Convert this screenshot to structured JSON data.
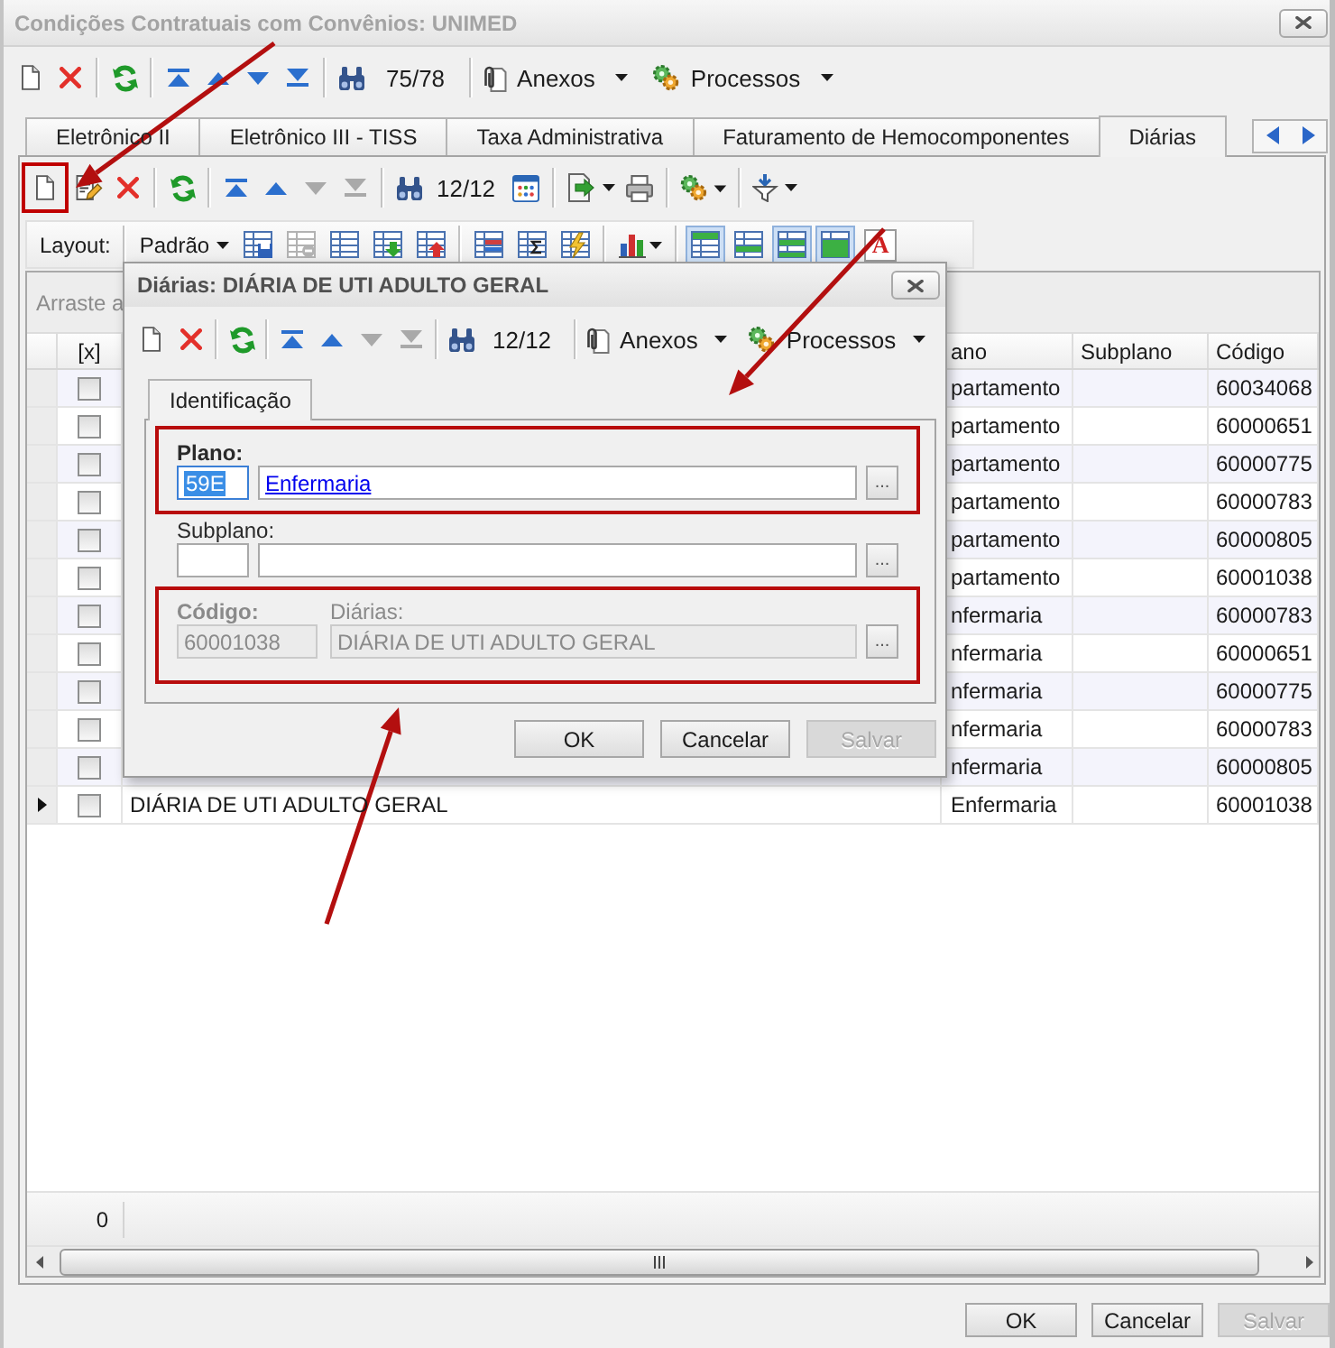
{
  "window": {
    "title": "Condições Contratuais com Convênios: UNIMED"
  },
  "toolbar": {
    "navigation": [
      {
        "disabled": false
      },
      {
        "disabled": false
      },
      {
        "disabled": false
      },
      {
        "disabled": false
      }
    ],
    "record_counter": "75/78",
    "menus": [
      {
        "label": "Anexos"
      },
      {
        "label": "Processos"
      }
    ]
  },
  "tabs": [
    {
      "label": "Eletrônico II",
      "selected": false
    },
    {
      "label": "Eletrônico III - TISS",
      "selected": false
    },
    {
      "label": "Taxa Administrativa",
      "selected": false
    },
    {
      "label": "Faturamento de Hemocomponentes",
      "selected": false
    },
    {
      "label": "Diárias",
      "selected": true
    }
  ],
  "grid_toolbar": {
    "new_highlighted": true,
    "navigation": [
      {
        "disabled": false
      },
      {
        "disabled": false
      },
      {
        "disabled": true
      },
      {
        "disabled": true
      }
    ],
    "record_counter": "12/12"
  },
  "layout_bar": {
    "label": "Layout:",
    "layout": "Padrão",
    "actions": [
      {
        "disabled": false
      },
      {
        "disabled": true
      },
      {
        "disabled": false
      },
      {
        "disabled": false
      },
      {
        "disabled": false
      }
    ],
    "view_toggles": [
      {
        "on": true
      },
      {
        "on": false
      },
      {
        "on": true
      },
      {
        "on": true
      }
    ],
    "font_button": "A"
  },
  "grid": {
    "group_panel_hint": "Arraste a",
    "columns": {
      "checkbox": "[x]",
      "column_4": "ano",
      "subplan": "Subplano",
      "code": "Código"
    },
    "rows": [
      {
        "selected": false,
        "checked": false,
        "column_4": "partamento",
        "code": "60034068"
      },
      {
        "selected": false,
        "checked": false,
        "column_4": "partamento",
        "code": "60000651"
      },
      {
        "selected": false,
        "checked": false,
        "column_4": "partamento",
        "code": "60000775"
      },
      {
        "selected": false,
        "checked": false,
        "column_4": "partamento",
        "code": "60000783"
      },
      {
        "selected": false,
        "checked": false,
        "column_4": "partamento",
        "code": "60000805"
      },
      {
        "selected": false,
        "checked": false,
        "column_4": "partamento",
        "code": "60001038"
      },
      {
        "selected": false,
        "checked": false,
        "column_4": "nfermaria",
        "code": "60000783"
      },
      {
        "selected": false,
        "checked": false,
        "column_4": "nfermaria",
        "code": "60000651"
      },
      {
        "selected": false,
        "checked": false,
        "column_4": "nfermaria",
        "code": "60000775"
      },
      {
        "selected": false,
        "checked": false,
        "column_4": "nfermaria",
        "code": "60000783"
      },
      {
        "selected": false,
        "checked": false,
        "column_4": "nfermaria",
        "code": "60000805"
      },
      {
        "selected": true,
        "checked": false,
        "column_3": "DIÁRIA DE UTI ADULTO GERAL",
        "column_4": "Enfermaria",
        "code": "60001038"
      }
    ],
    "footer_count": "0"
  },
  "dialog": {
    "title": "Diárias: DIÁRIA DE UTI ADULTO GERAL",
    "toolbar": {
      "navigation": [
        {
          "disabled": false
        },
        {
          "disabled": false
        },
        {
          "disabled": true
        },
        {
          "disabled": true
        }
      ],
      "record_counter": "12/12",
      "menus": [
        {
          "label": "Anexos"
        },
        {
          "label": "Processos"
        }
      ]
    },
    "tabs": [
      {
        "label": "Identificação",
        "selected": true
      }
    ],
    "fields": [
      {
        "kind": "lookup",
        "label": "Plano:",
        "required": true,
        "highlighted": true,
        "disabled": false,
        "value": "59E",
        "value_selected": true,
        "description": "Enfermaria",
        "link": true,
        "browse": "..."
      },
      {
        "kind": "lookup",
        "label": "Subplano:",
        "required": false,
        "highlighted": false,
        "disabled": false,
        "value_selected": false,
        "browse": "..."
      },
      {
        "kind": "pair",
        "label": "Código:",
        "required": true,
        "highlighted": true,
        "disabled": true,
        "value": "60001038",
        "value_selected": false,
        "description_label": "Diárias:",
        "description": "DIÁRIA DE UTI ADULTO GERAL",
        "link": false,
        "browse": "..."
      }
    ],
    "buttons": [
      {
        "label": "OK",
        "disabled": false
      },
      {
        "label": "Cancelar",
        "disabled": false
      },
      {
        "label": "Salvar",
        "disabled": true
      }
    ]
  },
  "buttons": [
    {
      "label": "OK",
      "disabled": false
    },
    {
      "label": "Cancelar",
      "disabled": false
    },
    {
      "label": "Salvar",
      "disabled": true
    }
  ]
}
